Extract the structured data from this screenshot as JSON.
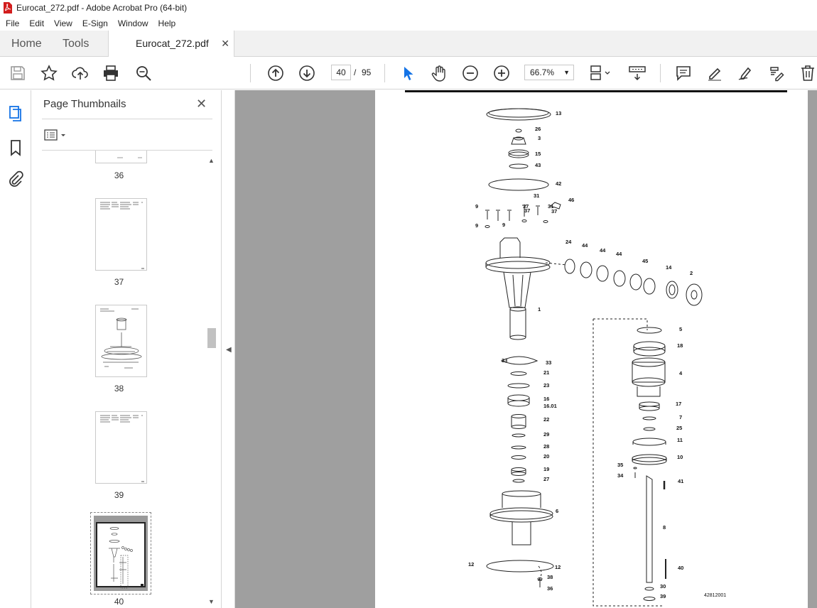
{
  "window": {
    "title": "Eurocat_272.pdf - Adobe Acrobat Pro (64-bit)"
  },
  "menu": [
    "File",
    "Edit",
    "View",
    "E-Sign",
    "Window",
    "Help"
  ],
  "tabs": {
    "home": "Home",
    "tools": "Tools",
    "document": "Eurocat_272.pdf"
  },
  "toolbar": {
    "current_page": "40",
    "separator": "/",
    "total_pages": "95",
    "zoom": "66.7%"
  },
  "panel": {
    "title": "Page Thumbnails",
    "thumbnails": [
      {
        "label": "36"
      },
      {
        "label": "37"
      },
      {
        "label": "38"
      },
      {
        "label": "39"
      },
      {
        "label": "40"
      }
    ]
  },
  "document": {
    "part_labels": [
      "13",
      "26",
      "3",
      "15",
      "43",
      "42",
      "31",
      "46",
      "37",
      "31",
      "37",
      "37",
      "9",
      "9",
      "9",
      "24",
      "44",
      "44",
      "44",
      "45",
      "14",
      "2",
      "1",
      "5",
      "18",
      "33",
      "33",
      "21",
      "23",
      "4",
      "16",
      "16.01",
      "17",
      "7",
      "22",
      "25",
      "29",
      "11",
      "28",
      "10",
      "20",
      "35",
      "19",
      "34",
      "41",
      "27",
      "6",
      "8",
      "40",
      "12",
      "12",
      "38",
      "36",
      "30",
      "39"
    ],
    "drawing_number": "42812001"
  },
  "colors": {
    "accent": "#1473e6",
    "pdf_red": "#d21d1d",
    "doc_bg": "#9f9f9f"
  }
}
